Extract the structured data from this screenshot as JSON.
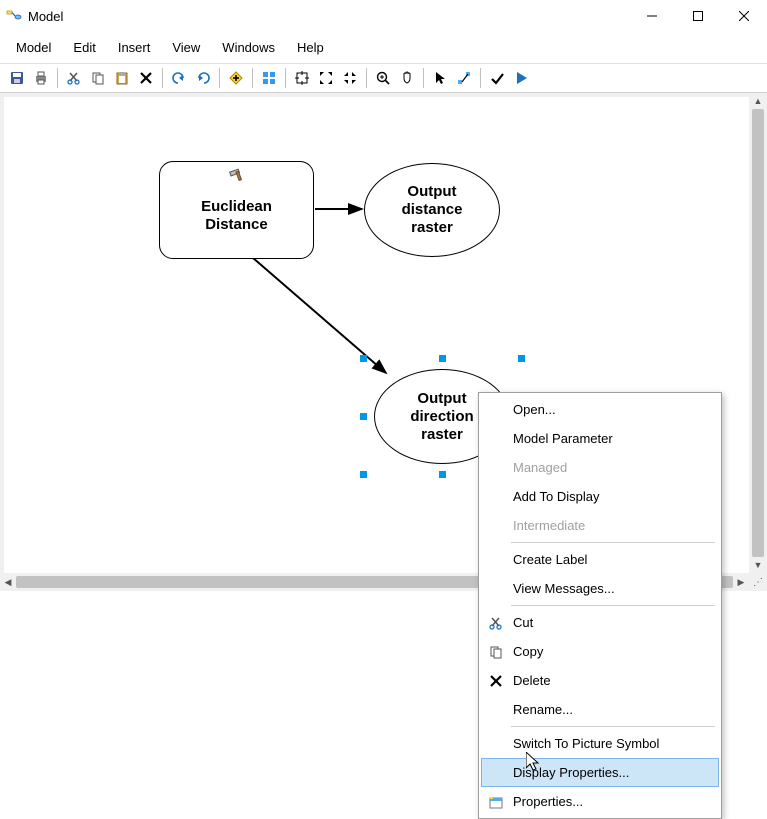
{
  "window": {
    "title": "Model"
  },
  "menubar": [
    "Model",
    "Edit",
    "Insert",
    "View",
    "Windows",
    "Help"
  ],
  "nodes": {
    "euclidean": {
      "line1": "Euclidean",
      "line2": "Distance"
    },
    "out_dist": {
      "line1": "Output",
      "line2": "distance",
      "line3": "raster"
    },
    "out_dir": {
      "line1": "Output",
      "line2": "direction",
      "line3": "raster"
    }
  },
  "context_menu": {
    "items": [
      {
        "label": "Open...",
        "icon": "",
        "enabled": true
      },
      {
        "label": "Model Parameter",
        "icon": "",
        "enabled": true
      },
      {
        "label": "Managed",
        "icon": "",
        "enabled": false
      },
      {
        "label": "Add To Display",
        "icon": "",
        "enabled": true
      },
      {
        "label": "Intermediate",
        "icon": "",
        "enabled": false
      },
      {
        "sep": true
      },
      {
        "label": "Create Label",
        "icon": "",
        "enabled": true
      },
      {
        "label": "View Messages...",
        "icon": "",
        "enabled": true
      },
      {
        "sep": true
      },
      {
        "label": "Cut",
        "icon": "cut",
        "enabled": true
      },
      {
        "label": "Copy",
        "icon": "copy",
        "enabled": true
      },
      {
        "label": "Delete",
        "icon": "delete",
        "enabled": true
      },
      {
        "label": "Rename...",
        "icon": "",
        "enabled": true
      },
      {
        "sep": true
      },
      {
        "label": "Switch To Picture Symbol",
        "icon": "",
        "enabled": true
      },
      {
        "label": "Display Properties...",
        "icon": "",
        "enabled": true,
        "highlighted": true
      },
      {
        "label": "Properties...",
        "icon": "props",
        "enabled": true
      }
    ]
  }
}
